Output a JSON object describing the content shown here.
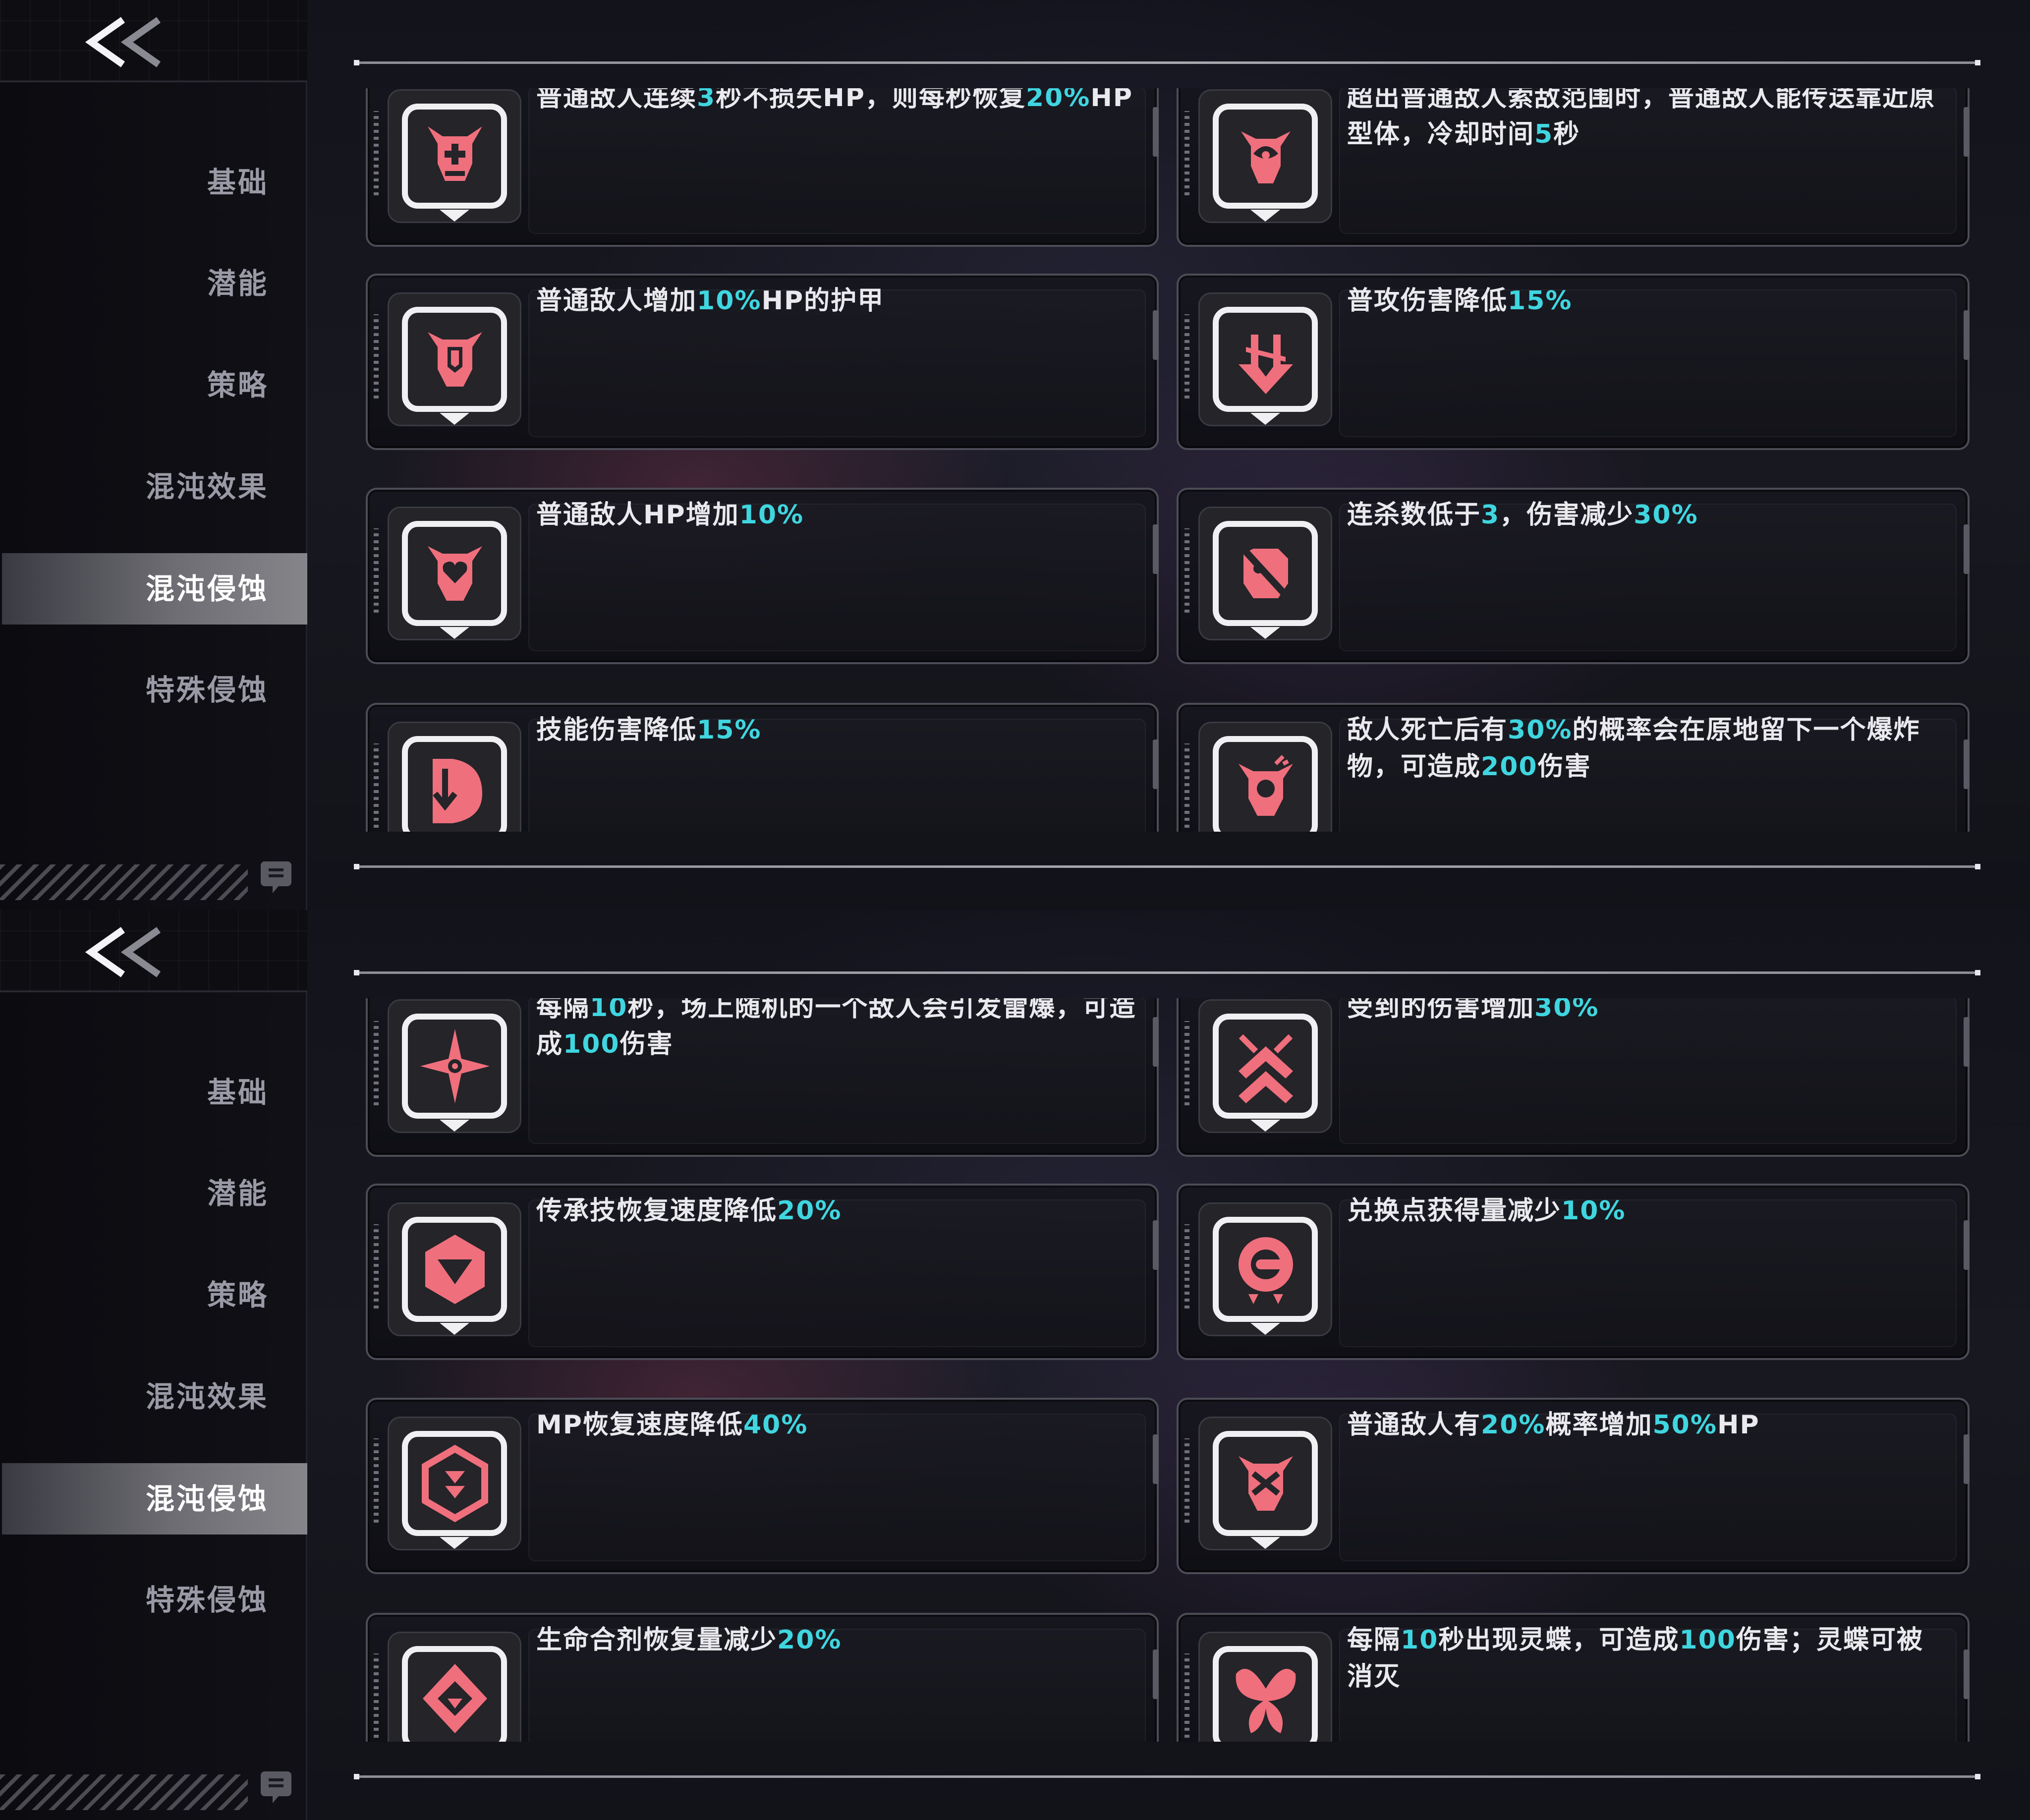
{
  "colors": {
    "accent_cyan": "#3fd6e0",
    "icon_pink": "#ef6f7c",
    "active_tab": "#85858a",
    "text": "#e9e9ee"
  },
  "nav": {
    "back_icon": "double-chevron-left-icon",
    "items": [
      "基础",
      "潜能",
      "策略",
      "混沌效果",
      "混沌侵蚀",
      "特殊侵蚀"
    ],
    "active_index": 4,
    "info_icon": "info-badge-icon"
  },
  "panels": [
    {
      "cards": [
        {
          "icon": "skull-plus-icon",
          "segments": [
            {
              "t": "普通敌人连续"
            },
            {
              "t": "3",
              "h": true
            },
            {
              "t": "秒不损失HP，则每秒恢复"
            },
            {
              "t": "20%",
              "h": true
            },
            {
              "t": "HP"
            }
          ]
        },
        {
          "icon": "skull-swirl-icon",
          "segments": [
            {
              "t": "超出普通敌人索敌范围时，普通敌人能传送靠近原型体，冷却时间"
            },
            {
              "t": "5",
              "h": true
            },
            {
              "t": "秒"
            }
          ]
        },
        {
          "icon": "skull-shield-icon",
          "segments": [
            {
              "t": "普通敌人增加"
            },
            {
              "t": "10%",
              "h": true
            },
            {
              "t": "HP的护甲"
            }
          ]
        },
        {
          "icon": "down-arrow-strike-icon",
          "segments": [
            {
              "t": "普攻伤害降低"
            },
            {
              "t": "15%",
              "h": true
            }
          ]
        },
        {
          "icon": "skull-heart-icon",
          "segments": [
            {
              "t": "普通敌人HP增加"
            },
            {
              "t": "10%",
              "h": true
            }
          ]
        },
        {
          "icon": "skull-slash-icon",
          "segments": [
            {
              "t": "连杀数低于"
            },
            {
              "t": "3",
              "h": true
            },
            {
              "t": "，伤害减少"
            },
            {
              "t": "30%",
              "h": true
            }
          ]
        },
        {
          "icon": "skill-down-icon",
          "segments": [
            {
              "t": "技能伤害降低"
            },
            {
              "t": "15%",
              "h": true
            }
          ]
        },
        {
          "icon": "skull-bomb-icon",
          "segments": [
            {
              "t": "敌人死亡后有"
            },
            {
              "t": "30%",
              "h": true
            },
            {
              "t": "的概率会在原地留下一个爆炸物，可造成"
            },
            {
              "t": "200",
              "h": true
            },
            {
              "t": "伤害"
            }
          ]
        }
      ]
    },
    {
      "cards": [
        {
          "icon": "star-burst-icon",
          "segments": [
            {
              "t": "每隔"
            },
            {
              "t": "10",
              "h": true
            },
            {
              "t": "秒，场上随机的一个敌人会引发雷爆，可造成"
            },
            {
              "t": "100",
              "h": true
            },
            {
              "t": "伤害"
            }
          ]
        },
        {
          "icon": "broken-chevrons-icon",
          "segments": [
            {
              "t": "受到的伤害增加"
            },
            {
              "t": "30%",
              "h": true
            }
          ]
        },
        {
          "icon": "hexagon-down-icon",
          "segments": [
            {
              "t": "传承技恢复速度降低"
            },
            {
              "t": "20%",
              "h": true
            }
          ]
        },
        {
          "icon": "exchange-point-icon",
          "segments": [
            {
              "t": "兑换点获得量减少"
            },
            {
              "t": "10%",
              "h": true
            }
          ]
        },
        {
          "icon": "mp-hexagon-icon",
          "segments": [
            {
              "t": "MP恢复速度降低"
            },
            {
              "t": "40%",
              "h": true
            }
          ]
        },
        {
          "icon": "skull-crossbones-icon",
          "segments": [
            {
              "t": "普通敌人有"
            },
            {
              "t": "20%",
              "h": true
            },
            {
              "t": "概率增加"
            },
            {
              "t": "50%",
              "h": true
            },
            {
              "t": "HP"
            }
          ]
        },
        {
          "icon": "potion-down-icon",
          "segments": [
            {
              "t": "生命合剂恢复量减少"
            },
            {
              "t": "20%",
              "h": true
            }
          ]
        },
        {
          "icon": "butterfly-icon",
          "segments": [
            {
              "t": "每隔"
            },
            {
              "t": "10",
              "h": true
            },
            {
              "t": "秒出现灵蝶，可造成"
            },
            {
              "t": "100",
              "h": true
            },
            {
              "t": "伤害；灵蝶可被消灭"
            }
          ]
        }
      ]
    }
  ]
}
